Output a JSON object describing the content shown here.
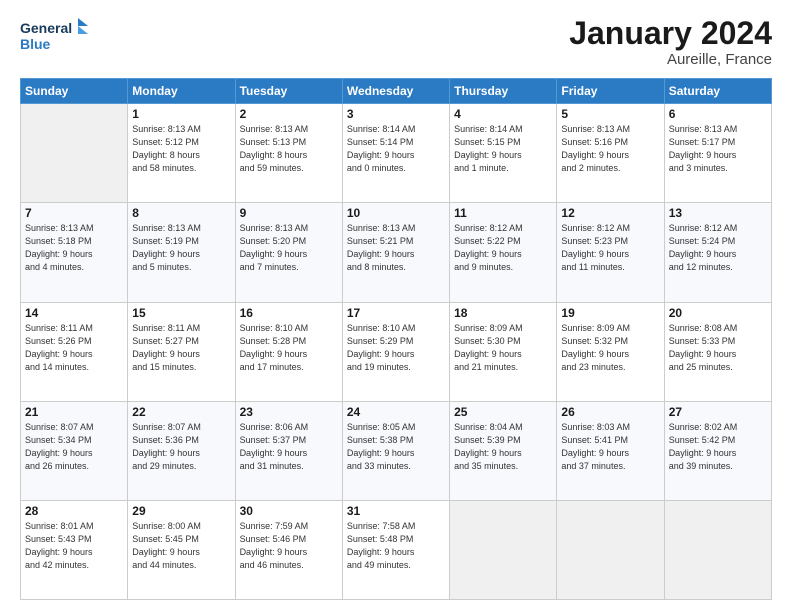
{
  "header": {
    "logo_line1": "General",
    "logo_line2": "Blue",
    "month": "January 2024",
    "location": "Aureille, France"
  },
  "weekdays": [
    "Sunday",
    "Monday",
    "Tuesday",
    "Wednesday",
    "Thursday",
    "Friday",
    "Saturday"
  ],
  "weeks": [
    [
      {
        "day": "",
        "info": ""
      },
      {
        "day": "1",
        "info": "Sunrise: 8:13 AM\nSunset: 5:12 PM\nDaylight: 8 hours\nand 58 minutes."
      },
      {
        "day": "2",
        "info": "Sunrise: 8:13 AM\nSunset: 5:13 PM\nDaylight: 8 hours\nand 59 minutes."
      },
      {
        "day": "3",
        "info": "Sunrise: 8:14 AM\nSunset: 5:14 PM\nDaylight: 9 hours\nand 0 minutes."
      },
      {
        "day": "4",
        "info": "Sunrise: 8:14 AM\nSunset: 5:15 PM\nDaylight: 9 hours\nand 1 minute."
      },
      {
        "day": "5",
        "info": "Sunrise: 8:13 AM\nSunset: 5:16 PM\nDaylight: 9 hours\nand 2 minutes."
      },
      {
        "day": "6",
        "info": "Sunrise: 8:13 AM\nSunset: 5:17 PM\nDaylight: 9 hours\nand 3 minutes."
      }
    ],
    [
      {
        "day": "7",
        "info": "Sunrise: 8:13 AM\nSunset: 5:18 PM\nDaylight: 9 hours\nand 4 minutes."
      },
      {
        "day": "8",
        "info": "Sunrise: 8:13 AM\nSunset: 5:19 PM\nDaylight: 9 hours\nand 5 minutes."
      },
      {
        "day": "9",
        "info": "Sunrise: 8:13 AM\nSunset: 5:20 PM\nDaylight: 9 hours\nand 7 minutes."
      },
      {
        "day": "10",
        "info": "Sunrise: 8:13 AM\nSunset: 5:21 PM\nDaylight: 9 hours\nand 8 minutes."
      },
      {
        "day": "11",
        "info": "Sunrise: 8:12 AM\nSunset: 5:22 PM\nDaylight: 9 hours\nand 9 minutes."
      },
      {
        "day": "12",
        "info": "Sunrise: 8:12 AM\nSunset: 5:23 PM\nDaylight: 9 hours\nand 11 minutes."
      },
      {
        "day": "13",
        "info": "Sunrise: 8:12 AM\nSunset: 5:24 PM\nDaylight: 9 hours\nand 12 minutes."
      }
    ],
    [
      {
        "day": "14",
        "info": "Sunrise: 8:11 AM\nSunset: 5:26 PM\nDaylight: 9 hours\nand 14 minutes."
      },
      {
        "day": "15",
        "info": "Sunrise: 8:11 AM\nSunset: 5:27 PM\nDaylight: 9 hours\nand 15 minutes."
      },
      {
        "day": "16",
        "info": "Sunrise: 8:10 AM\nSunset: 5:28 PM\nDaylight: 9 hours\nand 17 minutes."
      },
      {
        "day": "17",
        "info": "Sunrise: 8:10 AM\nSunset: 5:29 PM\nDaylight: 9 hours\nand 19 minutes."
      },
      {
        "day": "18",
        "info": "Sunrise: 8:09 AM\nSunset: 5:30 PM\nDaylight: 9 hours\nand 21 minutes."
      },
      {
        "day": "19",
        "info": "Sunrise: 8:09 AM\nSunset: 5:32 PM\nDaylight: 9 hours\nand 23 minutes."
      },
      {
        "day": "20",
        "info": "Sunrise: 8:08 AM\nSunset: 5:33 PM\nDaylight: 9 hours\nand 25 minutes."
      }
    ],
    [
      {
        "day": "21",
        "info": "Sunrise: 8:07 AM\nSunset: 5:34 PM\nDaylight: 9 hours\nand 26 minutes."
      },
      {
        "day": "22",
        "info": "Sunrise: 8:07 AM\nSunset: 5:36 PM\nDaylight: 9 hours\nand 29 minutes."
      },
      {
        "day": "23",
        "info": "Sunrise: 8:06 AM\nSunset: 5:37 PM\nDaylight: 9 hours\nand 31 minutes."
      },
      {
        "day": "24",
        "info": "Sunrise: 8:05 AM\nSunset: 5:38 PM\nDaylight: 9 hours\nand 33 minutes."
      },
      {
        "day": "25",
        "info": "Sunrise: 8:04 AM\nSunset: 5:39 PM\nDaylight: 9 hours\nand 35 minutes."
      },
      {
        "day": "26",
        "info": "Sunrise: 8:03 AM\nSunset: 5:41 PM\nDaylight: 9 hours\nand 37 minutes."
      },
      {
        "day": "27",
        "info": "Sunrise: 8:02 AM\nSunset: 5:42 PM\nDaylight: 9 hours\nand 39 minutes."
      }
    ],
    [
      {
        "day": "28",
        "info": "Sunrise: 8:01 AM\nSunset: 5:43 PM\nDaylight: 9 hours\nand 42 minutes."
      },
      {
        "day": "29",
        "info": "Sunrise: 8:00 AM\nSunset: 5:45 PM\nDaylight: 9 hours\nand 44 minutes."
      },
      {
        "day": "30",
        "info": "Sunrise: 7:59 AM\nSunset: 5:46 PM\nDaylight: 9 hours\nand 46 minutes."
      },
      {
        "day": "31",
        "info": "Sunrise: 7:58 AM\nSunset: 5:48 PM\nDaylight: 9 hours\nand 49 minutes."
      },
      {
        "day": "",
        "info": ""
      },
      {
        "day": "",
        "info": ""
      },
      {
        "day": "",
        "info": ""
      }
    ]
  ]
}
